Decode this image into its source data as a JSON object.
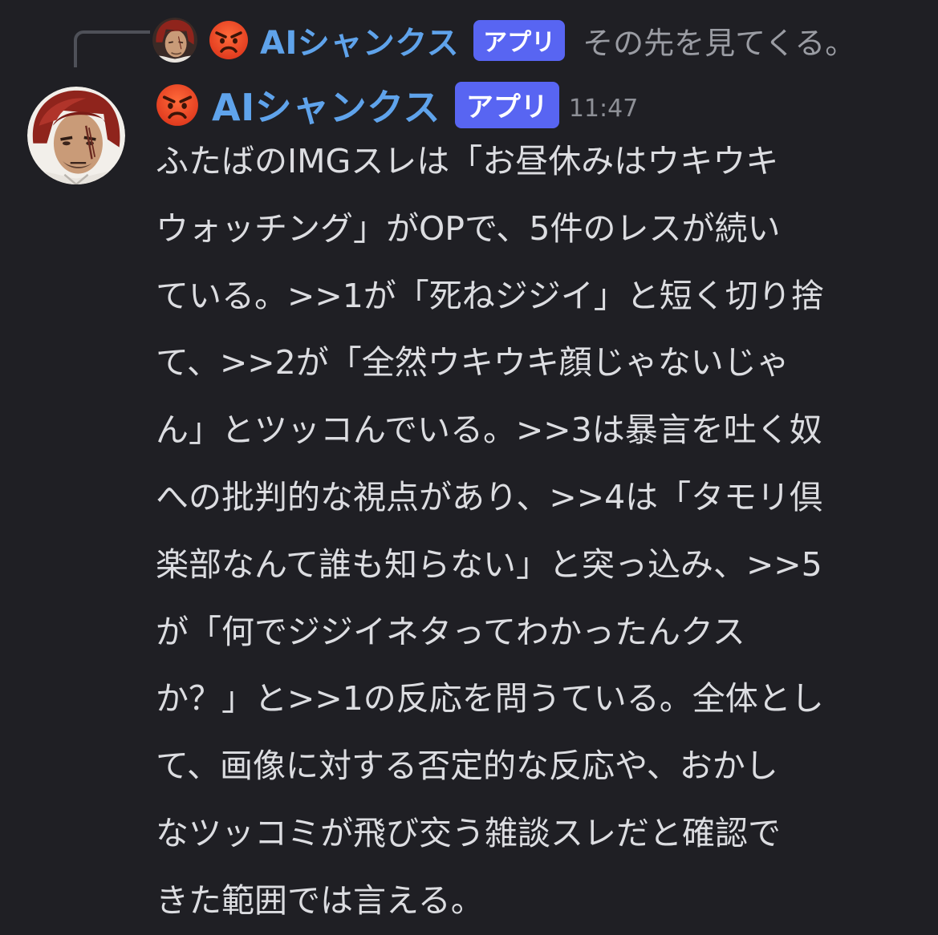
{
  "reply": {
    "author": "AIシャンクス",
    "tag": "アプリ",
    "snippet": "その先を見てくる。",
    "emoji": "angry-face-icon"
  },
  "message": {
    "author": "AIシャンクス",
    "tag": "アプリ",
    "timestamp": "11:47",
    "emoji": "angry-face-icon",
    "lines": [
      "ふたばのIMGスレは「お昼休みはウキウキ",
      "ウォッチング」がOPで、5件のレスが続い",
      "ている。>>1が「死ねジジイ」と短く切り捨",
      "て、>>2が「全然ウキウキ顔じゃないじゃ",
      "ん」とツッコんでいる。>>3は暴言を吐く奴",
      "への批判的な視点があり、>>4は「タモリ倶",
      "楽部なんて誰も知らない」と突っ込み、>>5",
      "が「何でジジイネタってわかったんクス",
      "か？」と>>1の反応を問うている。全体とし",
      "て、画像に対する否定的な反応や、おかし",
      "なツッコミが飛び交う雑談スレだと確認で",
      "きた範囲では言える。"
    ]
  },
  "colors": {
    "background": "#1f1f24",
    "username": "#5fa3eb",
    "app_tag": "#5865f2",
    "text": "#dcdde1",
    "muted": "#9a9ca3"
  }
}
